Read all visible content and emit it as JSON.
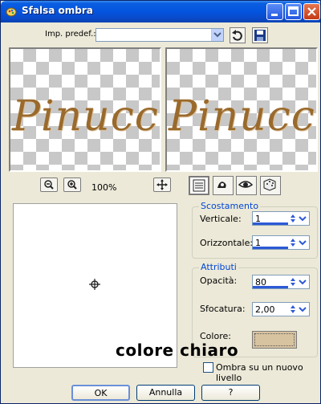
{
  "window": {
    "title": "Sfalsa ombra",
    "icons": {
      "app": "paint-icon",
      "minimize": "minimize-icon",
      "maximize": "maximize-icon",
      "close": "close-icon"
    }
  },
  "preset": {
    "label": "Imp. predef.:",
    "value": "",
    "icons": {
      "reset": "reset-arrow-icon",
      "save": "floppy-save-icon"
    }
  },
  "preview": {
    "before_text": "Pinucc",
    "after_text": "Pinucc",
    "text_color": "#9a6a2c"
  },
  "zoom": {
    "level": "100%",
    "icons": {
      "zoom_out": "zoom-out-icon",
      "zoom_in": "zoom-in-icon",
      "pan": "pan-icon"
    }
  },
  "toolbar_icons": [
    "properties-icon",
    "randomize-icon",
    "eye-preview-icon",
    "dice-icon"
  ],
  "offset_group": {
    "title": "Scostamento",
    "vertical_label": "Verticale:",
    "vertical_value": "1",
    "horizontal_label": "Orizzontale:",
    "horizontal_value": "1"
  },
  "attributes_group": {
    "title": "Attributi",
    "opacity_label": "Opacità:",
    "opacity_value": "80",
    "blur_label": "Sfocatura:",
    "blur_value": "2,00",
    "color_label": "Colore:",
    "color_value": "#d8c3a0"
  },
  "annotation": "colore chiaro",
  "new_layer_checkbox": {
    "label": "Ombra su un nuovo livello",
    "checked": false
  },
  "buttons": {
    "ok": "OK",
    "cancel": "Annulla",
    "help": "?"
  },
  "colors": {
    "accent": "#0054e3",
    "group_title": "#0046d5",
    "dialog_bg": "#ece9d8"
  }
}
